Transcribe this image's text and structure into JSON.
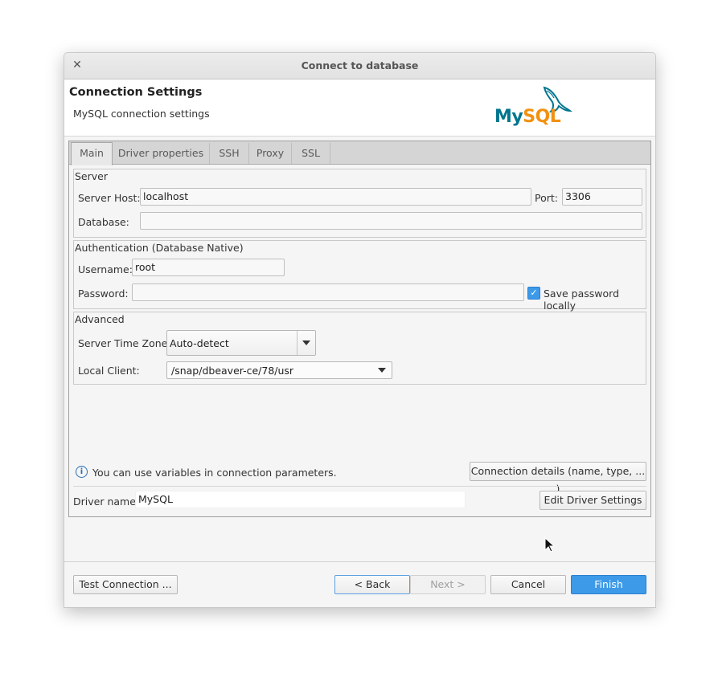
{
  "window": {
    "title": "Connect to database"
  },
  "header": {
    "title": "Connection Settings",
    "subtitle": "MySQL connection settings",
    "logo_my": "My",
    "logo_sql": "SQL"
  },
  "tabs": [
    {
      "label": "Main",
      "active": true
    },
    {
      "label": "Driver properties",
      "active": false
    },
    {
      "label": "SSH",
      "active": false
    },
    {
      "label": "Proxy",
      "active": false
    },
    {
      "label": "SSL",
      "active": false
    }
  ],
  "server": {
    "legend": "Server",
    "host_label": "Server Host:",
    "host_value": "localhost",
    "port_label": "Port:",
    "port_value": "3306",
    "database_label": "Database:",
    "database_value": ""
  },
  "auth": {
    "legend": "Authentication (Database Native)",
    "username_label": "Username:",
    "username_value": "root",
    "password_label": "Password:",
    "password_value": "",
    "save_password_label": "Save password locally",
    "save_password_checked": true
  },
  "advanced": {
    "legend": "Advanced",
    "timezone_label": "Server Time Zone:",
    "timezone_value": "Auto-detect",
    "local_client_label": "Local Client:",
    "local_client_value": "/snap/dbeaver-ce/78/usr"
  },
  "info": {
    "text": "You can use variables in connection parameters.",
    "details_button": "Connection details (name, type, ... )"
  },
  "driver": {
    "label": "Driver name:",
    "value": "MySQL",
    "edit_button": "Edit Driver Settings"
  },
  "footer": {
    "test_button": "Test Connection ...",
    "back_button": "< Back",
    "next_button": "Next >",
    "cancel_button": "Cancel",
    "finish_button": "Finish"
  },
  "colors": {
    "accent": "#3d9ae8",
    "mysql_blue": "#00758f",
    "mysql_orange": "#f29111"
  },
  "icons": {
    "close": "close-icon",
    "info": "info-icon",
    "logo": "mysql-dolphin-logo",
    "cursor": "mouse-pointer-icon"
  }
}
